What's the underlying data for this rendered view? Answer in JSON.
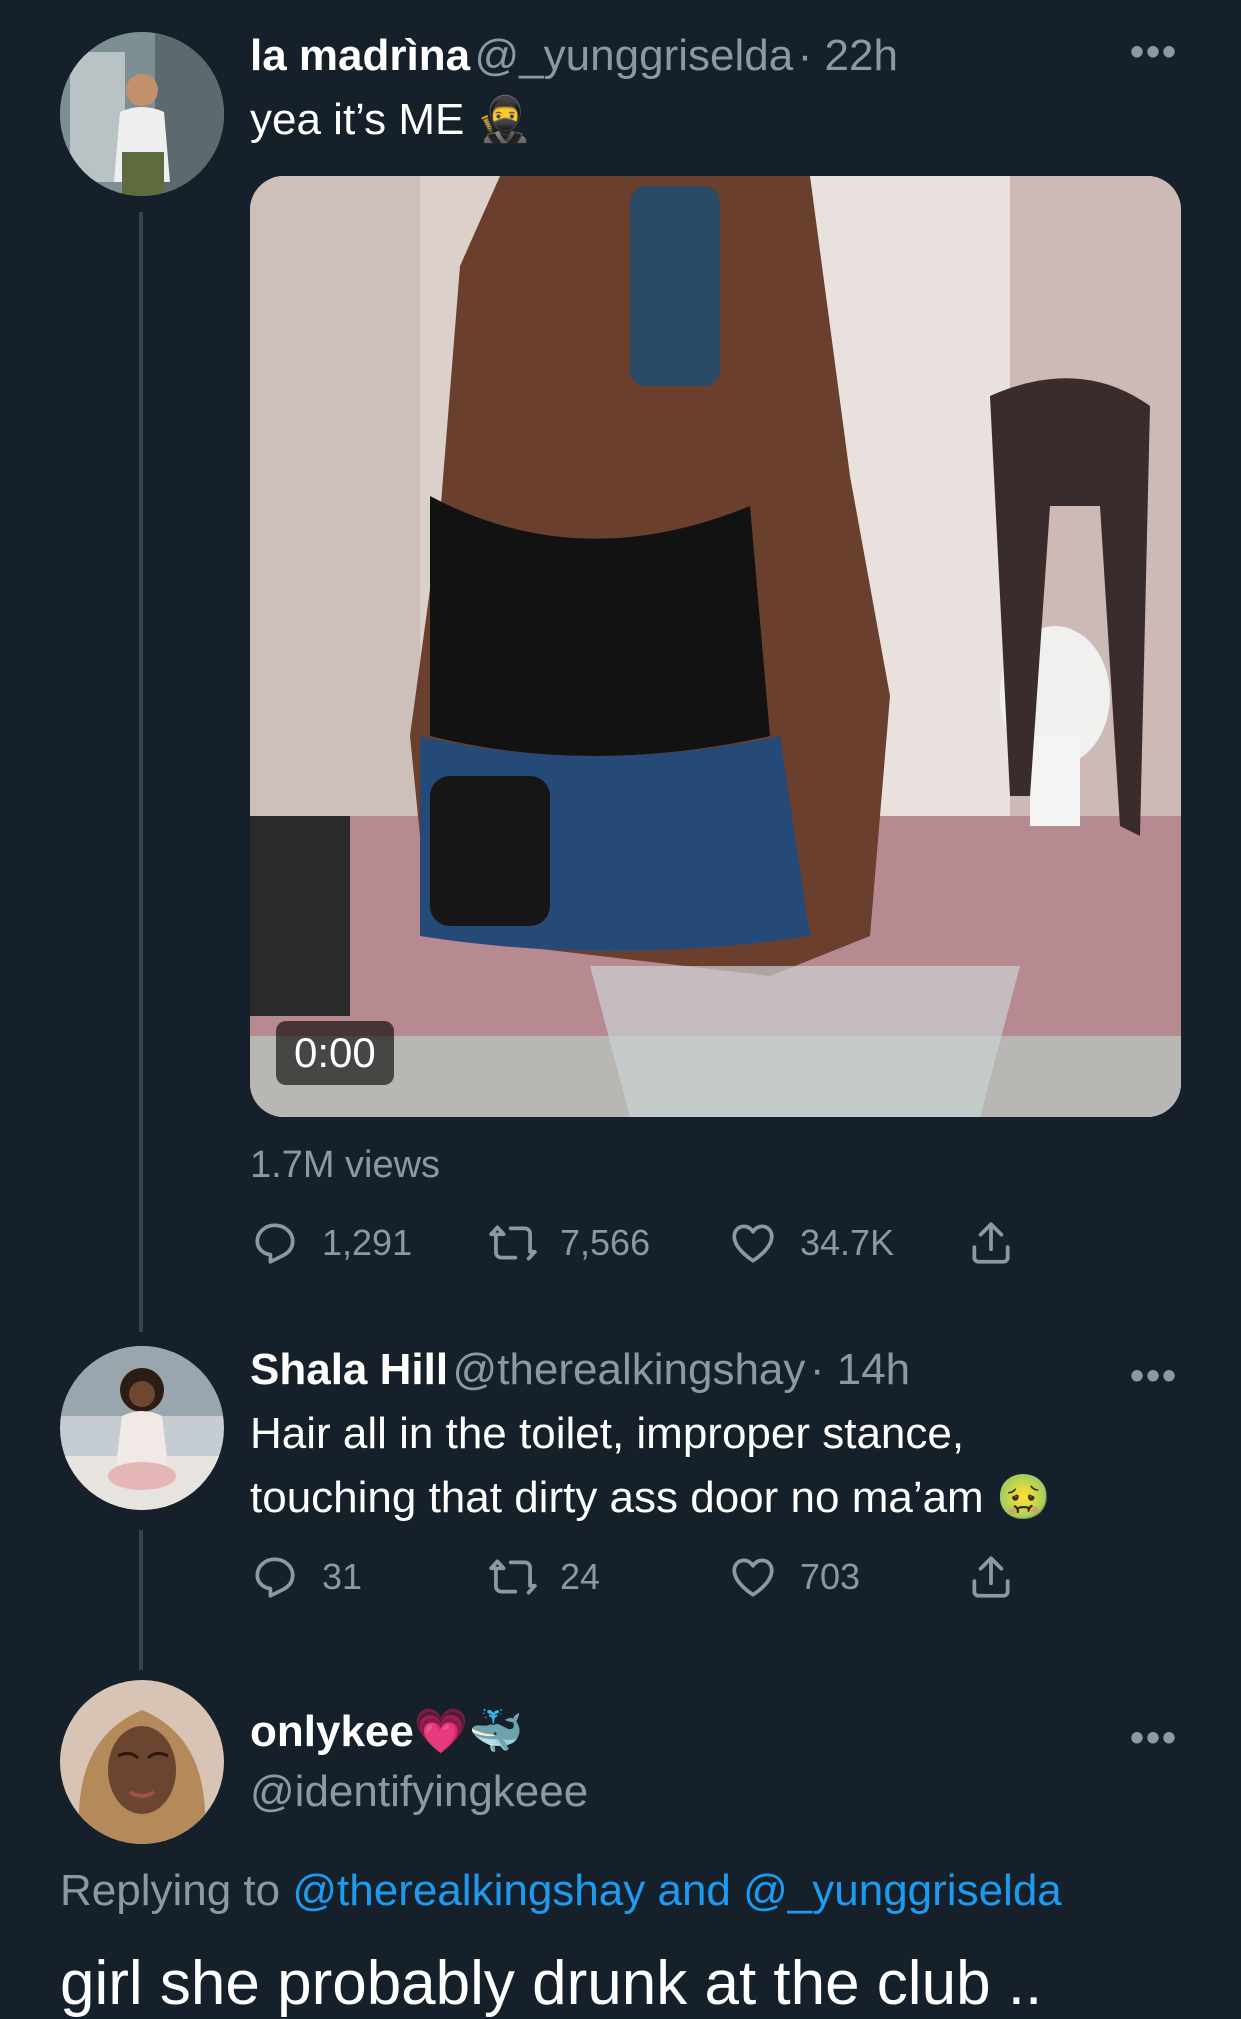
{
  "tweet1": {
    "name": "la madrìna",
    "handle": "@_yunggriselda",
    "time": "· 22h",
    "text": "yea it’s ME",
    "text_emoji": "🥷",
    "video_time": "0:00",
    "views": "1.7M views",
    "replies": "1,291",
    "retweets": "7,566",
    "likes": "34.7K"
  },
  "tweet2": {
    "name": "Shala Hill",
    "handle": "@therealkingshay",
    "time": "· 14h",
    "text_line1": "Hair all in the toilet, improper stance,",
    "text_line2": "touching that dirty ass door no ma’am",
    "text_emoji": "🤢",
    "replies": "31",
    "retweets": "24",
    "likes": "703"
  },
  "tweet3": {
    "name": "onlykee",
    "name_emojis": "💗🐳",
    "handle": "@identifyingkeee",
    "replying_prefix": "Replying to",
    "replying_user1": "@therealkingshay",
    "replying_and": "and",
    "replying_user2": "@_yunggriselda",
    "text": "girl she probably drunk at the club .."
  },
  "icons": {
    "more": "more-dots-icon",
    "reply": "reply-icon",
    "retweet": "retweet-icon",
    "like": "heart-icon",
    "share": "share-icon"
  },
  "colors": {
    "background": "#15202b",
    "secondary_text": "#8b98a5",
    "link": "#1d9bf0",
    "thread_line": "#38444d"
  }
}
